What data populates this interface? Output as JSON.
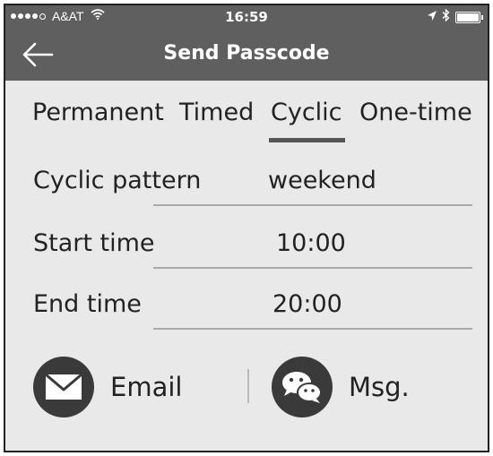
{
  "status_bar": {
    "carrier": "A&AT",
    "time": "16:59",
    "icons": [
      "signal-dots-icon",
      "wifi-icon",
      "location-arrow-icon",
      "bluetooth-icon",
      "battery-icon"
    ]
  },
  "nav": {
    "title": "Send Passcode",
    "back_icon": "back-arrow-icon"
  },
  "tabs": [
    {
      "label": "Permanent",
      "selected": false
    },
    {
      "label": "Timed",
      "selected": false
    },
    {
      "label": "Cyclic",
      "selected": true
    },
    {
      "label": "One-time",
      "selected": false
    }
  ],
  "form": {
    "cyclic_pattern": {
      "label": "Cyclic pattern",
      "value": "weekend"
    },
    "start_time": {
      "label": "Start time",
      "value": "10:00"
    },
    "end_time": {
      "label": "End time",
      "value": "20:00"
    }
  },
  "share": {
    "email": {
      "label": "Email",
      "icon": "envelope-icon"
    },
    "msg": {
      "label": "Msg.",
      "icon": "chat-bubbles-icon"
    }
  },
  "colors": {
    "bar_background": "#5f5f5f",
    "page_background": "#e9e9e9",
    "icon_circle": "#3a3a3a"
  }
}
